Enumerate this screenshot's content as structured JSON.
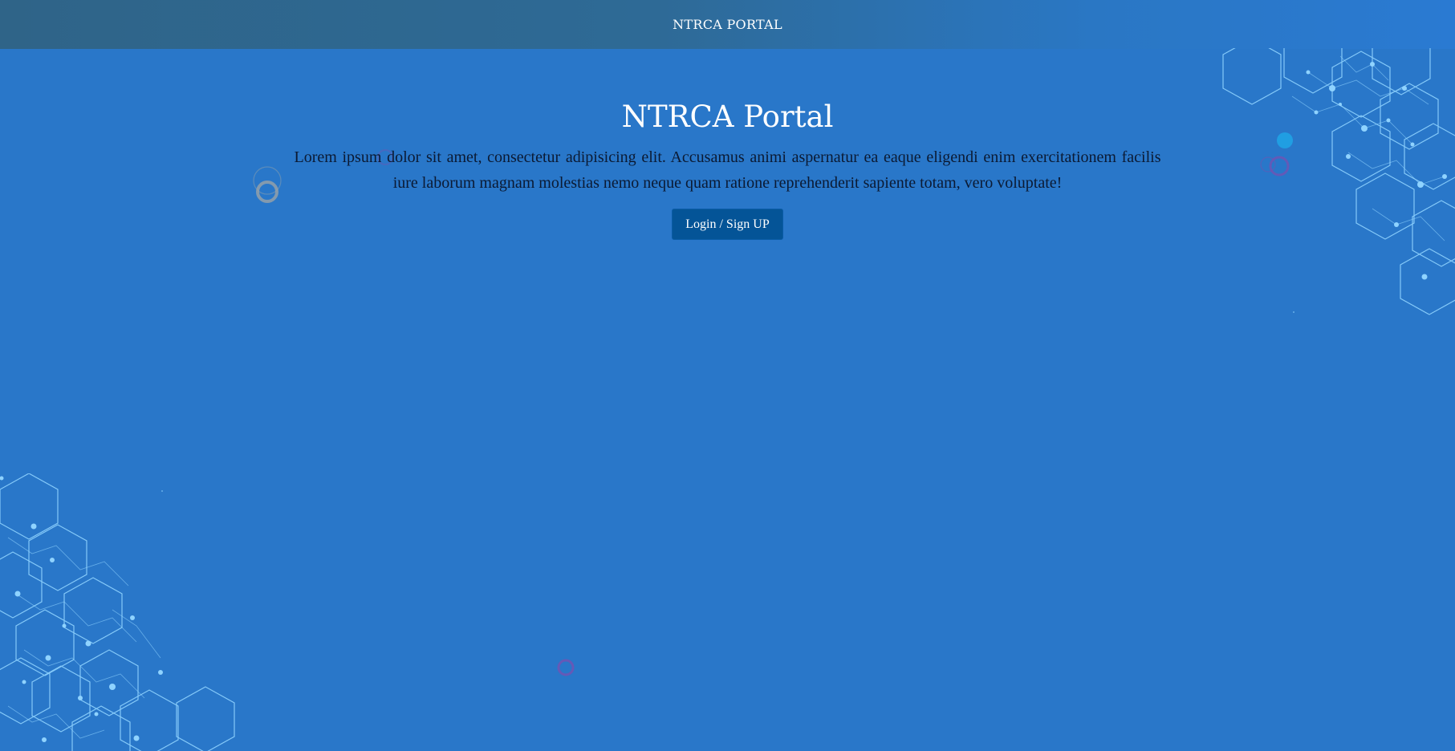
{
  "header": {
    "title": "NTRCA PORTAL"
  },
  "hero": {
    "title": "NTRCA Portal",
    "description": "Lorem ipsum dolor sit amet, consectetur adipisicing elit. Accusamus animi aspernatur ea eaque eligendi enim exercitationem facilis iure laborum magnam molestias nemo neque quam ratione reprehenderit sapiente totam, vero voluptate!",
    "button_label": "Login / Sign UP"
  },
  "theme": {
    "background": "#2977c9",
    "header_gradient_start": "#2f6488",
    "header_gradient_end": "#2a7ad2",
    "button_color": "#045497",
    "hex_line_color": "#8fd3ff",
    "ring_color_grey": "#9aa3a8",
    "ring_color_purple": "#7a4fb0"
  },
  "decorations": {
    "top_right": "hexagon-network-graphic",
    "bottom_left": "hexagon-network-graphic",
    "floating_circles": "circle-particles"
  }
}
